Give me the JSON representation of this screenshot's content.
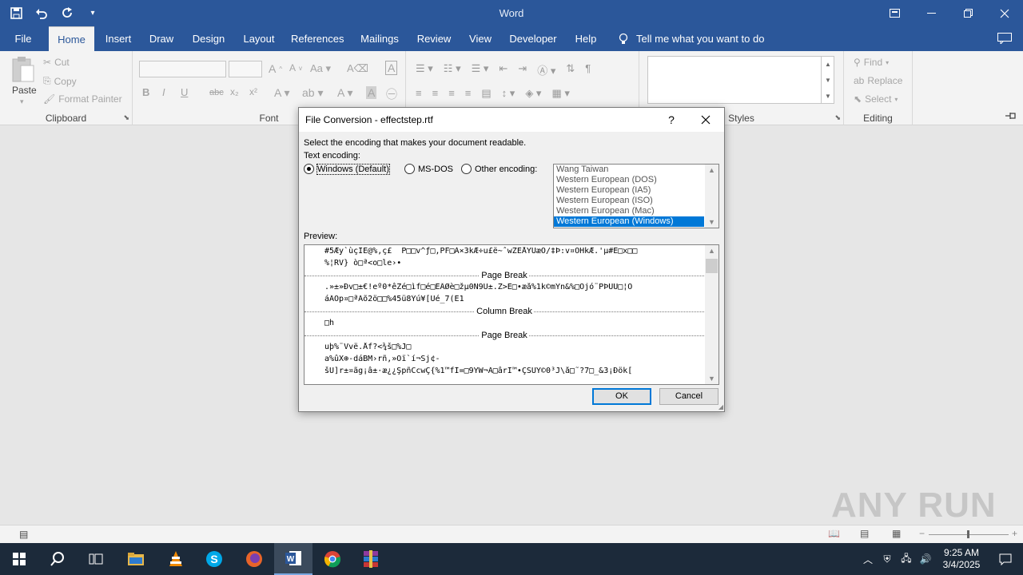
{
  "app": {
    "title": "Word",
    "quick_access": [
      "save-icon",
      "undo-icon",
      "redo-icon",
      "customize-icon"
    ]
  },
  "tabs": [
    {
      "label": "File"
    },
    {
      "label": "Home",
      "active": true
    },
    {
      "label": "Insert"
    },
    {
      "label": "Draw"
    },
    {
      "label": "Design"
    },
    {
      "label": "Layout"
    },
    {
      "label": "References"
    },
    {
      "label": "Mailings"
    },
    {
      "label": "Review"
    },
    {
      "label": "View"
    },
    {
      "label": "Developer"
    },
    {
      "label": "Help"
    }
  ],
  "tell_me": "Tell me what you want to do",
  "ribbon": {
    "clipboard": {
      "label": "Clipboard",
      "paste": "Paste",
      "cut": "Cut",
      "copy": "Copy",
      "format_painter": "Format Painter"
    },
    "font": {
      "label": "Font",
      "buttons": [
        "B",
        "I",
        "U",
        "abc",
        "x₂",
        "x²"
      ]
    },
    "styles": {
      "label": "Styles"
    },
    "editing": {
      "label": "Editing",
      "find": "Find",
      "replace": "Replace",
      "select": "Select"
    }
  },
  "dialog": {
    "title": "File Conversion - effectstep.rtf",
    "help": "?",
    "instruction": "Select the encoding that makes your document readable.",
    "text_encoding_label": "Text encoding:",
    "options": [
      {
        "label": "Windows (Default)",
        "checked": true
      },
      {
        "label": "MS-DOS",
        "checked": false
      },
      {
        "label": "Other encoding:",
        "checked": false
      }
    ],
    "encodings": [
      "Wang Taiwan",
      "Western European (DOS)",
      "Western European (IA5)",
      "Western European (ISO)",
      "Western European (Mac)",
      "Western European (Windows)"
    ],
    "selected_encoding": "Western European (Windows)",
    "preview_label": "Preview:",
    "preview_lines": [
      "#5Æy`ùçIE@%,ç£  P□□v^ƒ□,PF□À×3kÆ÷u£ë~ˆwZEÅŸÜæÒ/‡Þ:v¤OHkÆ.'µ#E□x□□",
      "%¦RV} ò□ª<o□le›•",
      ".»±»Ðv□±€!eº0*êZé□ìf□é□EÂØè□žµ0Ñ9Ù±.Z>E□•æå%1k©mŸn&%□Õjó¨PÞUÙ□¦Ô",
      "áÃÒp¤□ªAõ2ö□□%45ü8Ýú¥[Ûé_7(E1",
      "□h",
      "uþ%¨Vvë.Åf?<¾š□%J□",
      "a%ûX⊕-dáBM›rñ,»Ôï`í¬Sj¢-",
      "šÛ]r±¤ãg¡â±·æ¿¿ŞpñCcwÇ{%1™fÌ=□9ŸW¬Ã□ârÏ™•ÇŠÜŸ©0³J\\å□˜?7□_&3¡Ðök["
    ],
    "breaks": [
      "Page Break",
      "Column Break",
      "Page Break"
    ],
    "ok": "OK",
    "cancel": "Cancel"
  },
  "watermark": "ANY RUN",
  "taskbar": {
    "time": "9:25 AM",
    "date": "3/4/2025",
    "apps": [
      "start-icon",
      "search-icon",
      "task-view-icon",
      "file-explorer-icon",
      "vlc-icon",
      "skype-icon",
      "firefox-icon",
      "word-icon",
      "chrome-icon",
      "winrar-icon"
    ]
  }
}
